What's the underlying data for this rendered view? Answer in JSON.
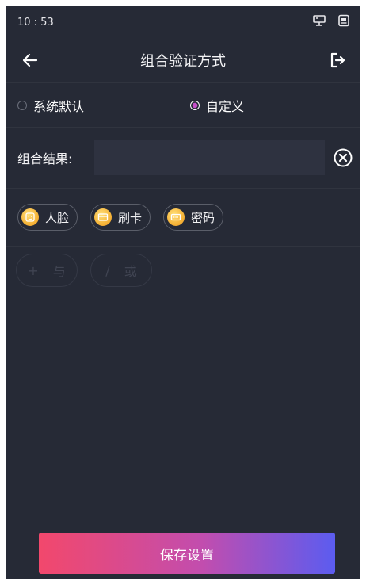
{
  "status_bar": {
    "time": "10 : 53",
    "icons": [
      "network-status-icon",
      "device-status-icon"
    ]
  },
  "header": {
    "title": "组合验证方式",
    "back_icon": "arrow-left-icon",
    "exit_icon": "logout-icon"
  },
  "mode": {
    "options": [
      {
        "label": "系统默认",
        "checked": false
      },
      {
        "label": "自定义",
        "checked": true
      }
    ],
    "accent_color": "#c64fc8"
  },
  "result": {
    "label": "组合结果:",
    "value": "",
    "clear_icon": "clear-circle-icon"
  },
  "methods": [
    {
      "label": "人脸",
      "icon": "face-icon"
    },
    {
      "label": "刷卡",
      "icon": "card-icon"
    },
    {
      "label": "密码",
      "icon": "password-icon"
    }
  ],
  "operators": [
    {
      "symbol": "+",
      "label": "与"
    },
    {
      "symbol": "/",
      "label": "或"
    }
  ],
  "save_button": {
    "label": "保存设置",
    "gradient": [
      "#f2486c",
      "#5b5cf0"
    ]
  }
}
